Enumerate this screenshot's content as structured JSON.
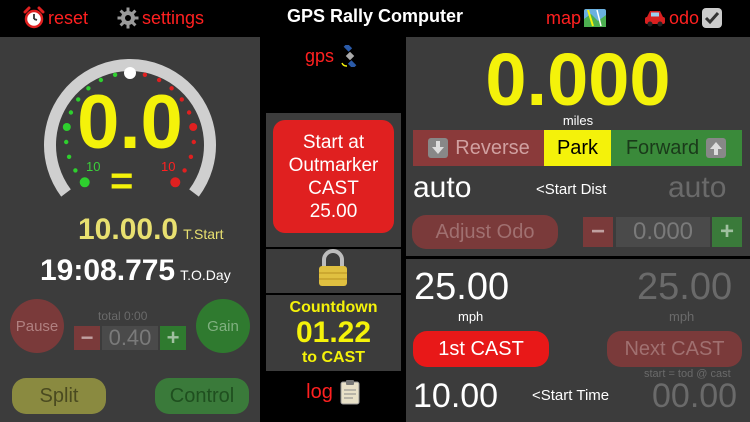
{
  "topbar": {
    "reset": "reset",
    "settings": "settings",
    "title": "GPS Rally Computer",
    "map": "map",
    "odo": "odo"
  },
  "left": {
    "speed": "0.0",
    "speed_status": "=",
    "gauge_low": "10",
    "gauge_high": "10",
    "t_start_value": "10.00.0",
    "t_start_label": "T.Start",
    "tod_value": "19:08.775",
    "tod_label": "T.O.Day",
    "pause": "Pause",
    "gain": "Gain",
    "total_label": "total 0:00",
    "minus": "−",
    "adjust_value": "0.40",
    "plus": "+",
    "split": "Split",
    "control": "Control"
  },
  "mid": {
    "gps": "gps",
    "start_line1": "Start at",
    "start_line2": "Outmarker",
    "start_line3": "CAST",
    "start_line4": "25.00",
    "countdown_label": "Countdown",
    "countdown_value": "01.22",
    "countdown_suffix": "to CAST",
    "log": "log"
  },
  "rtop": {
    "distance": "0.000",
    "distance_unit": "miles",
    "reverse": "Reverse",
    "park": "Park",
    "forward": "Forward",
    "mode_left": "auto",
    "start_dist": "<Start Dist",
    "mode_right": "auto",
    "adjust_odo": "Adjust Odo",
    "minus": "−",
    "odo_value": "0.000",
    "plus": "+"
  },
  "rbot": {
    "cast_value": "25.00",
    "cast_unit": "mph",
    "next_value": "25.00",
    "next_unit": "mph",
    "first_cast": "1st CAST",
    "next_cast": "Next CAST",
    "start_formula": "start = tod @ cast",
    "start_time": "10.00",
    "start_time_label": "<Start Time",
    "next_time": "00.00"
  }
}
